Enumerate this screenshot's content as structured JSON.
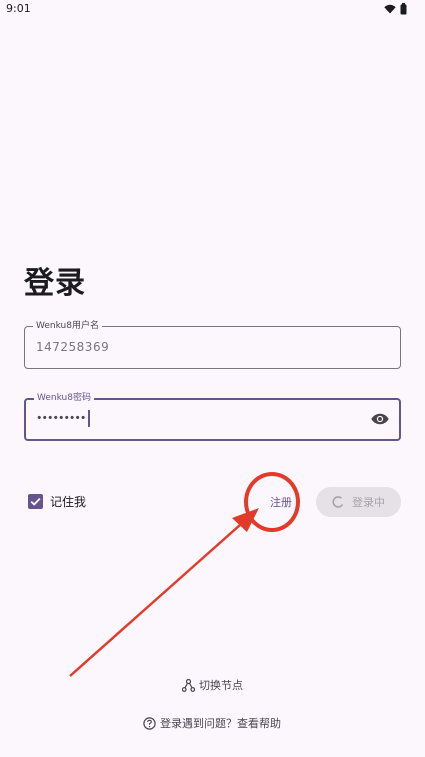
{
  "status_bar": {
    "time": "9:01",
    "icons": [
      "wifi-icon",
      "battery-icon"
    ]
  },
  "login": {
    "title": "登录",
    "username": {
      "label": "Wenku8用户名",
      "value": "147258369"
    },
    "password": {
      "label": "Wenku8密码",
      "value": "•••••••••",
      "visibility_icon": "eye-icon"
    },
    "remember_me": {
      "label": "记住我",
      "checked": true
    },
    "register_label": "注册",
    "submit": {
      "label": "登录中",
      "loading": true
    }
  },
  "footer": {
    "switch_node_label": "切换节点",
    "help_label": "登录遇到问题？查看帮助"
  },
  "colors": {
    "background": "#fcf7fd",
    "primary": "#65558f",
    "annotation": "#e23b2a"
  }
}
